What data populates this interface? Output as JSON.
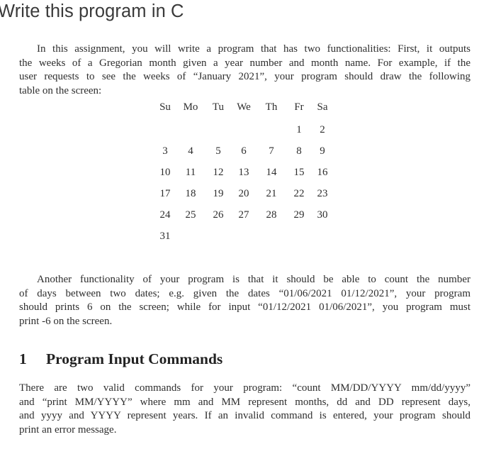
{
  "question_title": "Write this program in C",
  "intro_paragraph": {
    "lines": [
      "In this assignment, you will write a program that has two functionalities: First, it outputs",
      "the weeks of a Gregorian month given a year number and month name. For example, if the",
      "user requests to see the weeks of “January 2021”, your program should draw the following",
      "table on the screen:"
    ]
  },
  "calendar": {
    "month": "January",
    "year": "2021",
    "weekdays": [
      "Su",
      "Mo",
      "Tu",
      "We",
      "Th",
      "Fr",
      "Sa"
    ],
    "weeks": [
      [
        "",
        "",
        "",
        "",
        "",
        "1",
        "2"
      ],
      [
        "3",
        "4",
        "5",
        "6",
        "7",
        "8",
        "9"
      ],
      [
        "10",
        "11",
        "12",
        "13",
        "14",
        "15",
        "16"
      ],
      [
        "17",
        "18",
        "19",
        "20",
        "21",
        "22",
        "23"
      ],
      [
        "24",
        "25",
        "26",
        "27",
        "28",
        "29",
        "30"
      ],
      [
        "31",
        "",
        "",
        "",
        "",
        "",
        ""
      ]
    ]
  },
  "count_paragraph": {
    "lines": [
      "Another functionality of your program is that it should be able to count the number",
      "of days between two dates; e.g. given the dates “01/06/2021 01/12/2021”, your program",
      "should prints 6 on the screen; while for input “01/12/2021 01/06/2021”, you program must",
      "print -6 on the screen."
    ]
  },
  "section": {
    "number": "1",
    "title": "Program Input Commands"
  },
  "commands_paragraph": {
    "lines": [
      "There are two valid commands for your program: “count MM/DD/YYYY mm/dd/yyyy”",
      "and “print MM/YYYY” where mm and MM represent months, dd and DD represent days,",
      "and yyyy and YYYY represent years. If an invalid command is entered, your program should",
      "print an error message."
    ]
  }
}
